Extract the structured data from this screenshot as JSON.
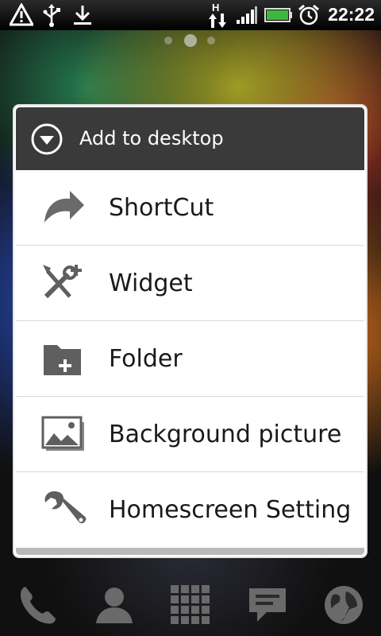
{
  "status_bar": {
    "time": "22:22",
    "network_type": "H",
    "icons": [
      "warning-icon",
      "usb-icon",
      "download-icon",
      "data-transfer-icon",
      "signal-icon",
      "battery-icon",
      "alarm-icon"
    ],
    "battery_color": "#3db83d"
  },
  "home": {
    "page_count": 3,
    "active_page": 2
  },
  "dialog": {
    "title": "Add to desktop",
    "items": [
      {
        "label": "ShortCut",
        "icon": "shortcut-arrow-icon"
      },
      {
        "label": "Widget",
        "icon": "widget-tools-icon"
      },
      {
        "label": "Folder",
        "icon": "folder-add-icon"
      },
      {
        "label": "Background picture",
        "icon": "picture-icon"
      },
      {
        "label": "Homescreen Setting",
        "icon": "wrench-icon"
      }
    ]
  },
  "dock": {
    "icons": [
      "phone-icon",
      "contacts-icon",
      "app-drawer-icon",
      "messages-icon",
      "browser-globe-icon"
    ]
  },
  "colors": {
    "header_bg": "#3a3a3a",
    "menu_bg": "#ffffff",
    "icon_gray": "#5f5f5f"
  }
}
